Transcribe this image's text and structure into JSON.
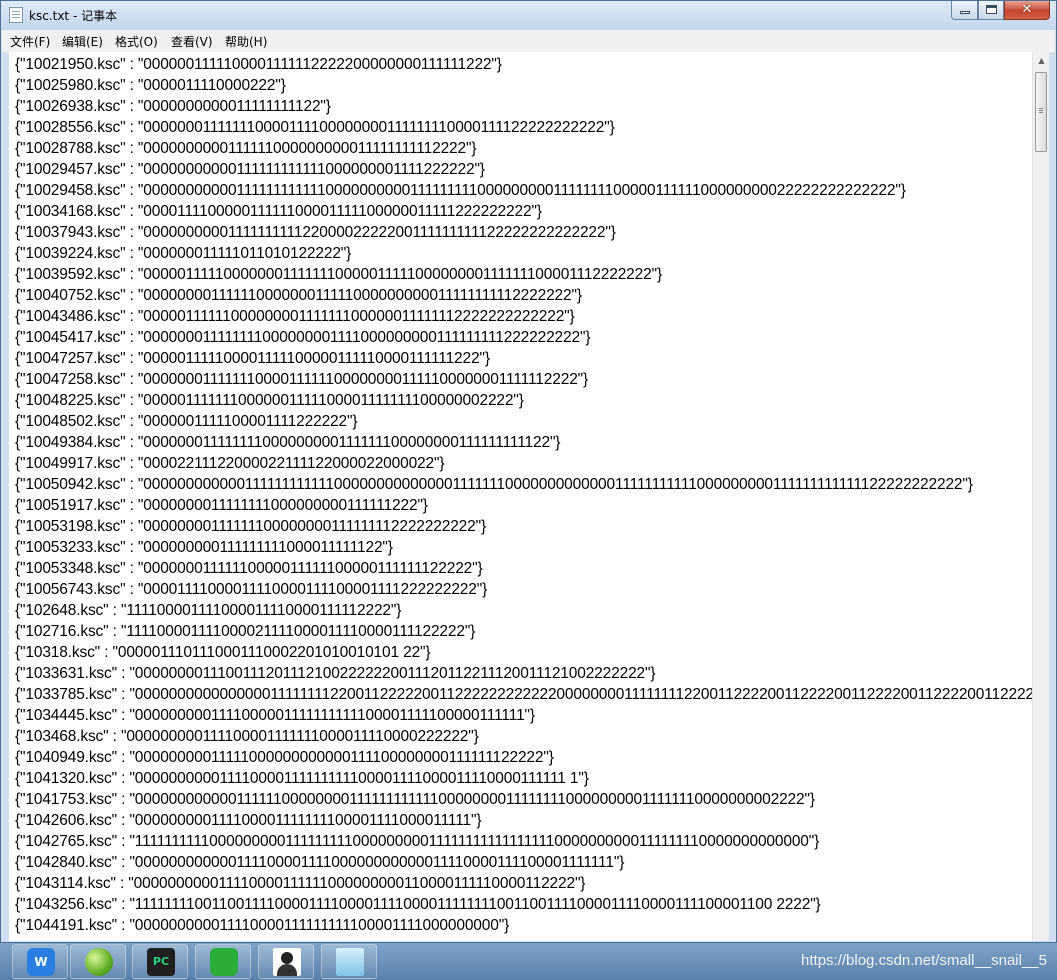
{
  "window": {
    "title": "ksc.txt - 记事本",
    "close_glyph": "✕"
  },
  "menu": [
    {
      "label": "文件(F)"
    },
    {
      "label": "编辑(E)"
    },
    {
      "label": "格式(O)"
    },
    {
      "label": "查看(V)"
    },
    {
      "label": "帮助(H)"
    }
  ],
  "editor": {
    "lines": [
      "{\"10021950.ksc\" : \"0000001111100001111112222200000000111111222\"}",
      "{\"10025980.ksc\" : \"0000011110000222\"}",
      "{\"10026938.ksc\" : \"0000000000011111111122\"}",
      "{\"10028556.ksc\" : \"000000011111110000111100000000111111110000111122222222222\"}",
      "{\"10028788.ksc\" : \"0000000000111111000000000011111111112222\"}",
      "{\"10029457.ksc\" : \"00000000000111111111111000000001111222222\"}",
      "{\"10029458.ksc\" : \"000000000001111111111110000000000111111111000000000111111110000011111100000000022222222222222\"}",
      "{\"10034168.ksc\" : \"000011110000011111100001111100000011111222222222\"}",
      "{\"10037943.ksc\" : \"000000000011111111112200002222200111111111122222222222222\"}",
      "{\"10039224.ksc\" : \"000000011111011010122222\"}",
      "{\"10039592.ksc\" : \"000001111100000001111111000001111100000000111111100001112222222\"}",
      "{\"10040752.ksc\" : \"00000000111111000000011111000000000011111111112222222\"}",
      "{\"10043486.ksc\" : \"0000011111100000000111111100000011111112222222222222\"}",
      "{\"10045417.ksc\" : \"000000011111111000000001111000000000111111111222222222\"}",
      "{\"10047257.ksc\" : \"000001111100001111100000111110000111111222\"}",
      "{\"10047258.ksc\" : \"000000011111110000111111000000001111100000001111112222\"}",
      "{\"10048225.ksc\" : \"0000011111110000001111100001111111100000002222\"}",
      "{\"10048502.ksc\" : \"0000001111100001111222222\"}",
      "{\"10049384.ksc\" : \"000000011111111000000000111111100000000111111111122\"}",
      "{\"10049917.ksc\" : \"00002211122000022111122000022000022\"}",
      "{\"10050942.ksc\" : \"000000000000111111111111000000000000001111111000000000000011111111111000000000111111111111122222222222\"}",
      "{\"10051917.ksc\" : \"0000000011111111000000000111111222\"}",
      "{\"10053198.ksc\" : \"00000000111111100000000111111112222222222\"}",
      "{\"10053233.ksc\" : \"000000000111111111000011111122\"}",
      "{\"10053348.ksc\" : \"00000001111110000011111100000111111122222\"}",
      "{\"10056743.ksc\" : \"00001111000011110000111100001111222222222\"}",
      "{\"102648.ksc\" : \"111100001111000011110000111112222\"}",
      "{\"102716.ksc\" : \"111100001111000021111000011110000111122222\"}",
      "{\"10318.ksc\" : \"0000011101110001110002201010010101 22\"}",
      "{\"1033631.ksc\" : \"00000000111001112011121002222220011120112211120011121002222222\"}",
      "{\"1033785.ksc\" : \"0000000000000000111111112200112222200112222222222220000000011111111220011222200112222001122220011222200112222\"}",
      "{\"1034445.ksc\" : \"0000000001111000001111111111100001111100000111111\"}",
      "{\"103468.ksc\" : \"000000000111100001111111000011110000222222\"}",
      "{\"1040949.ksc\" : \"00000000011111000000000000111100000000111111122222\"}",
      "{\"1041320.ksc\" : \"000000000011110000111111111100001111000011110000111111 1\"}",
      "{\"1041753.ksc\" : \"00000000000011111100000000111111111111000000001111111100000000011111110000000002222\"}",
      "{\"1042606.ksc\" : \"000000000111100001111111100001111000011111\"}",
      "{\"1042765.ksc\" : \"1111111111000000000111111111000000000111111111111111110000000000111111110000000000000\"}",
      "{\"1042840.ksc\" : \"00000000000011110000111100000000000011110000111100001111111\"}",
      "{\"1043114.ksc\" : \"000000000011110000111111000000000110000111110000112222\"}",
      "{\"1043256.ksc\" : \"11111111001100111100001111000011110000111111110011001111000011110000111100001100 2222\"}",
      "{\"1044191.ksc\" : \"000000000011110000111111111100001111000000000\"}"
    ]
  },
  "taskbar": {
    "items": [
      {
        "icon": "wps-office-icon",
        "label": "W"
      },
      {
        "icon": "green-ball-icon",
        "label": ""
      },
      {
        "icon": "pycharm-icon",
        "label": "PC"
      },
      {
        "icon": "wechat-icon",
        "label": ""
      },
      {
        "icon": "avatar-icon",
        "label": ""
      },
      {
        "icon": "notepad-icon",
        "label": ""
      }
    ],
    "watermark": "https://blog.csdn.net/small__snail__5"
  }
}
